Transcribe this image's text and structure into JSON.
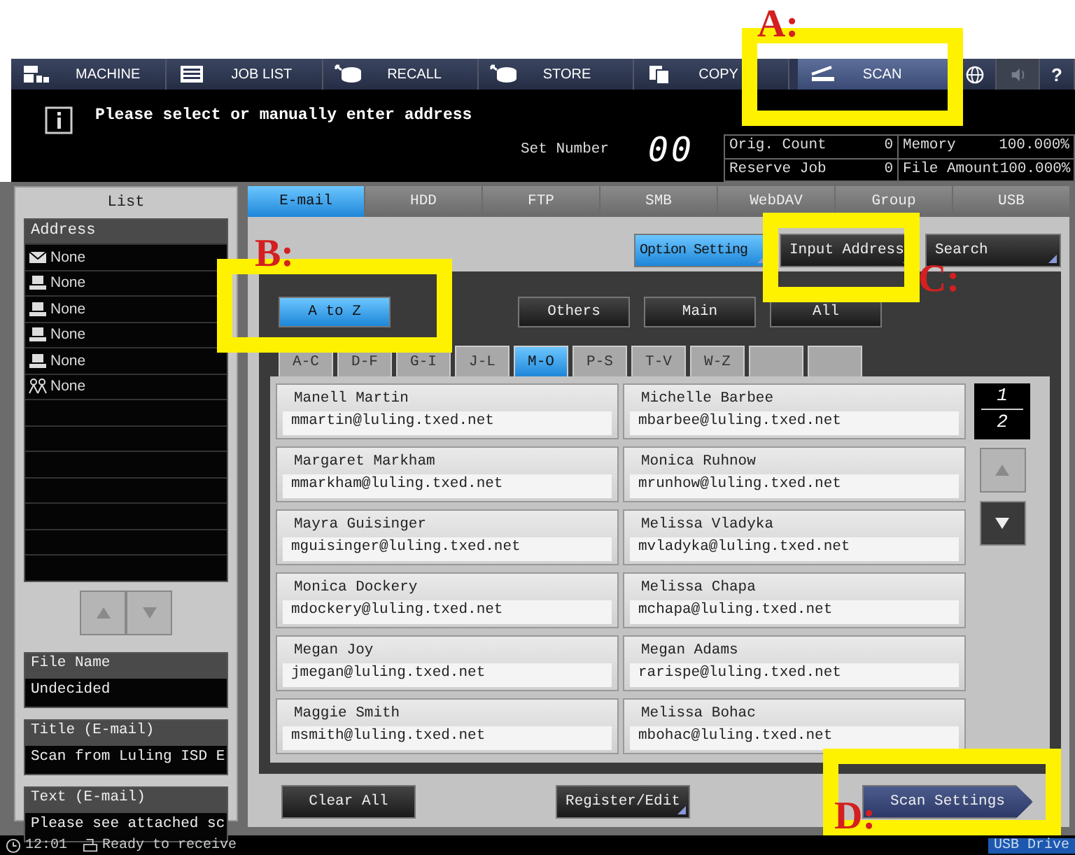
{
  "menu": [
    {
      "kind": "machine",
      "label": "MACHINE",
      "selected": false,
      "disabled": false
    },
    {
      "kind": "joblist",
      "label": "JOB LIST",
      "selected": false,
      "disabled": false
    },
    {
      "kind": "recall",
      "label": "RECALL",
      "selected": false,
      "disabled": false
    },
    {
      "kind": "store",
      "label": "STORE",
      "selected": false,
      "disabled": false
    },
    {
      "kind": "copy",
      "label": "COPY",
      "selected": false,
      "disabled": false
    },
    {
      "kind": "scan",
      "label": "SCAN",
      "selected": true,
      "disabled": false
    },
    {
      "kind": "globe",
      "selected": false,
      "disabled": false
    },
    {
      "kind": "speaker",
      "selected": false,
      "disabled": true
    },
    {
      "kind": "help",
      "label": "?",
      "selected": false,
      "disabled": false
    }
  ],
  "message": "Please select or manually enter address",
  "set_number": {
    "label": "Set Number",
    "value": "00"
  },
  "counters": [
    {
      "label": "Orig. Count",
      "value": "0"
    },
    {
      "label": "Memory",
      "value": "100.000%"
    },
    {
      "label": "Reserve Job",
      "value": "0"
    },
    {
      "label": "File Amount",
      "value": "100.000%"
    }
  ],
  "list": {
    "title": "List",
    "header": "Address",
    "scroll_disabled": true,
    "items": [
      {
        "kind": "email",
        "label": "None"
      },
      {
        "kind": "hdd",
        "label": "None"
      },
      {
        "kind": "ftp",
        "label": "None"
      },
      {
        "kind": "smb",
        "label": "None"
      },
      {
        "kind": "webdav",
        "label": "None"
      },
      {
        "kind": "group",
        "label": "None"
      }
    ]
  },
  "info_boxes": [
    {
      "label": "File Name",
      "value": "Undecided"
    },
    {
      "label": "Title (E-mail)",
      "value": "Scan from Luling ISD E"
    },
    {
      "label": "Text (E-mail)",
      "value": "Please see attached sc"
    }
  ],
  "dest_tabs": [
    {
      "label": "E-mail",
      "selected": true
    },
    {
      "label": "HDD",
      "selected": false
    },
    {
      "label": "FTP",
      "selected": false
    },
    {
      "label": "SMB",
      "selected": false
    },
    {
      "label": "WebDAV",
      "selected": false
    },
    {
      "label": "Group",
      "selected": false
    },
    {
      "label": "USB",
      "selected": false
    }
  ],
  "actions": [
    {
      "label": "Option Setting",
      "selected": true
    },
    {
      "label": "Input Address",
      "selected": false
    },
    {
      "label": "Search",
      "selected": false
    }
  ],
  "index_modes": [
    {
      "label": "A to Z",
      "selected": true
    },
    {
      "label": "Others",
      "selected": false
    },
    {
      "label": "Main",
      "selected": false
    },
    {
      "label": "All",
      "selected": false
    }
  ],
  "letter_tabs": [
    {
      "label": "A-C",
      "selected": false
    },
    {
      "label": "D-F",
      "selected": false
    },
    {
      "label": "G-I",
      "selected": false
    },
    {
      "label": "J-L",
      "selected": false
    },
    {
      "label": "M-O",
      "selected": true
    },
    {
      "label": "P-S",
      "selected": false
    },
    {
      "label": "T-V",
      "selected": false
    },
    {
      "label": "W-Z",
      "selected": false
    },
    {
      "selected": false
    },
    {
      "selected": false
    }
  ],
  "entries": [
    {
      "name": "Manell Martin",
      "email": "mmartin@luling.txed.net"
    },
    {
      "name": "Michelle Barbee",
      "email": "mbarbee@luling.txed.net"
    },
    {
      "name": "Margaret Markham",
      "email": "mmarkham@luling.txed.net"
    },
    {
      "name": "Monica Ruhnow",
      "email": "mrunhow@luling.txed.net"
    },
    {
      "name": "Mayra Guisinger",
      "email": "mguisinger@luling.txed.net"
    },
    {
      "name": "Melissa Vladyka",
      "email": "mvladyka@luling.txed.net"
    },
    {
      "name": "Monica Dockery",
      "email": "mdockery@luling.txed.net"
    },
    {
      "name": "Melissa Chapa",
      "email": "mchapa@luling.txed.net"
    },
    {
      "name": "Megan Joy",
      "email": "jmegan@luling.txed.net"
    },
    {
      "name": "Megan Adams",
      "email": "rarispe@luling.txed.net"
    },
    {
      "name": "Maggie Smith",
      "email": "msmith@luling.txed.net"
    },
    {
      "name": "Melissa Bohac",
      "email": "mbohac@luling.txed.net"
    }
  ],
  "page": {
    "current": "1",
    "total": "2",
    "up_disabled": true,
    "down_disabled": false
  },
  "bottom_buttons": [
    {
      "kind": "plain",
      "label": "Clear All"
    },
    {
      "kind": "menu",
      "label": "Register/Edit"
    },
    {
      "kind": "next",
      "label": "Scan Settings"
    }
  ],
  "status": {
    "time": "12:01",
    "message": "Ready to receive",
    "device": "USB Drive"
  },
  "annotations": [
    {
      "label": "A:"
    },
    {
      "label": "B:"
    },
    {
      "label": "C:"
    },
    {
      "label": "D:"
    }
  ]
}
